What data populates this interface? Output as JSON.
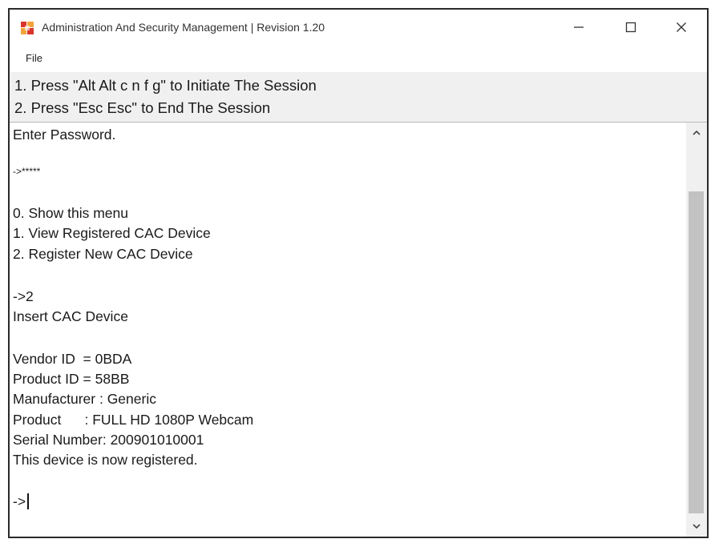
{
  "window": {
    "title": "Administration And Security Management | Revision 1.20",
    "controls": {
      "minimize": "minimize",
      "maximize": "maximize",
      "close": "close"
    }
  },
  "menubar": {
    "file_label": "File"
  },
  "instructions": {
    "line1": "1. Press \"Alt Alt c n f g\" to Initiate The Session",
    "line2": "2. Press \"Esc Esc\" to End The Session"
  },
  "console": {
    "lines": [
      "Enter Password.",
      "->*****",
      "0. Show this menu",
      "1. View Registered CAC Device",
      "2. Register New CAC Device",
      "->2",
      "Insert CAC Device",
      "Vendor ID  = 0BDA",
      "Product ID = 58BB",
      "Manufacturer : Generic",
      "Product      : FULL HD 1080P Webcam",
      "Serial Number: 200901010001",
      "This device is now registered.",
      "->"
    ]
  },
  "scrollbar": {
    "up_arrow": "scroll-up-arrow",
    "down_arrow": "scroll-down-arrow"
  },
  "colors": {
    "window_border": "#2a2a2a",
    "instructions_bg": "#f0f0f0",
    "scroll_thumb": "#c2c2c2",
    "icon_red": "#d9342b",
    "icon_orange": "#f2a43a"
  }
}
